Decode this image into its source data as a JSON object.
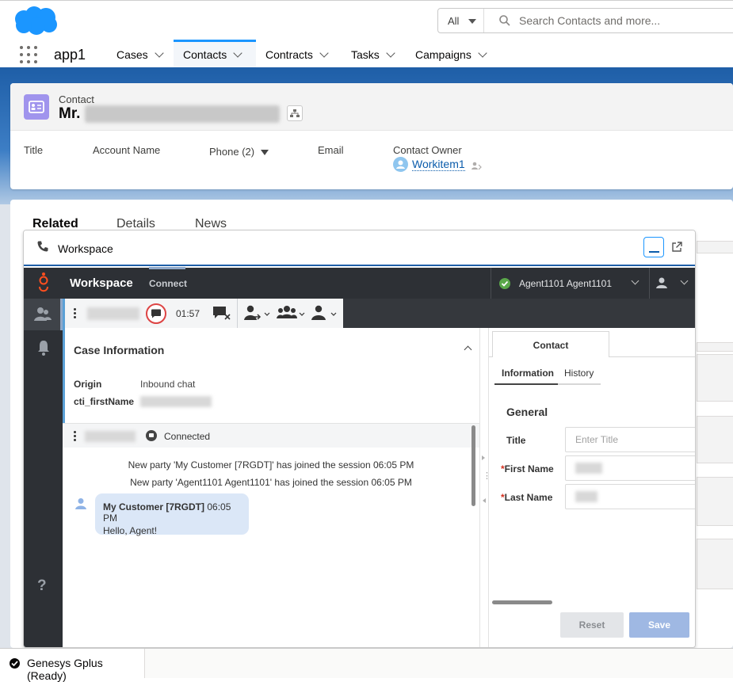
{
  "header": {
    "search_scope": "All",
    "search_placeholder": "Search Contacts and more..."
  },
  "nav": {
    "app_name": "app1",
    "tabs": [
      {
        "label": "Cases",
        "active": false
      },
      {
        "label": "Contacts",
        "active": true
      },
      {
        "label": "Contracts",
        "active": false
      },
      {
        "label": "Tasks",
        "active": false
      },
      {
        "label": "Campaigns",
        "active": false
      }
    ]
  },
  "record": {
    "type": "Contact",
    "name_prefix": "Mr.",
    "fields": {
      "title": "Title",
      "account_name": "Account Name",
      "phone": "Phone (2)",
      "email": "Email",
      "contact_owner": "Contact Owner",
      "owner_value": "Workitem1"
    },
    "tabs": [
      "Related",
      "Details",
      "News"
    ]
  },
  "workspace": {
    "title": "Workspace",
    "genesys": {
      "title": "Workspace",
      "connect": "Connect",
      "agent": "Agent1101 Agent1101"
    },
    "toolbar": {
      "timer": "01:57"
    },
    "case_info": {
      "title": "Case Information",
      "origin_label": "Origin",
      "origin_value": "Inbound chat",
      "firstname_label": "cti_firstName"
    },
    "chat": {
      "status": "Connected",
      "system_messages": [
        "New party 'My Customer [7RGDT]' has joined the session 06:05 PM",
        "New party 'Agent1101 Agent1101' has joined the session 06:05 PM"
      ],
      "message": {
        "from": "My Customer [7RGDT]",
        "time": "06:05 PM",
        "text": "Hello, Agent!"
      }
    },
    "contact_panel": {
      "tab": "Contact",
      "subtabs": [
        "Information",
        "History"
      ],
      "section": "General",
      "title_label": "Title",
      "title_placeholder": "Enter Title",
      "first_name_label": "First Name",
      "last_name_label": "Last Name",
      "reset": "Reset",
      "save": "Save"
    }
  },
  "utility_bar": {
    "item": "Genesys Gplus (Ready)"
  },
  "colors": {
    "brand_blue": "#1f5fa8",
    "salesforce_cloud": "#1b96ff",
    "genesys_dark": "#2d3035",
    "genesys_red": "#ff4f1f",
    "ready_green": "#5aa84a"
  }
}
